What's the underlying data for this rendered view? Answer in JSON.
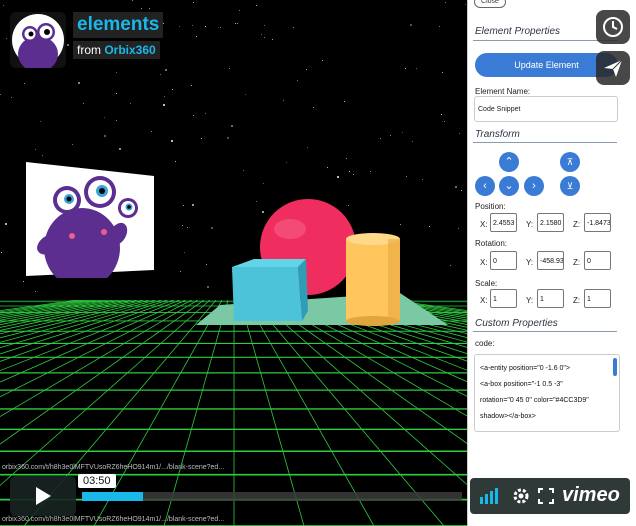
{
  "video": {
    "title": "elements",
    "from_prefix": "from",
    "channel": "Orbix360",
    "watermark": "orbix360.com/t/h8h3e0lMFTVUsoRZ6heHO914m1/.../blank-scene?ed...",
    "time": "03:50",
    "brand": "vimeo",
    "progress": 0.16
  },
  "panel": {
    "close_label": "Close",
    "element_properties": "Element Properties",
    "update_button": "Update Element",
    "element_name_label": "Element Name:",
    "element_name_value": "Code Snippet",
    "transform_title": "Transform",
    "position_label": "Position:",
    "position": {
      "x": "2.4553",
      "y": "2.1580",
      "z": "-1.8473"
    },
    "rotation_label": "Rotation:",
    "rotation": {
      "x": "0",
      "y": "-458.93",
      "z": "0"
    },
    "scale_label": "Scale:",
    "scale": {
      "x": "1",
      "y": "1",
      "z": "1"
    },
    "axis": {
      "x": "X:",
      "y": "Y:",
      "z": "Z:"
    },
    "custom_title": "Custom Properties",
    "code_label": "code:",
    "code_lines": [
      "<a-entity position=\"0 -1.6 0\">",
      "<a-box position=\"-1 0.5 -3\"",
      "rotation=\"0 45 0\" color=\"#4CC3D9\"",
      "shadow></a-box>"
    ]
  },
  "colors": {
    "accent": "#3a7bd5",
    "vimeo_blue": "#1ab7ea",
    "grid_green": "#2ecc40",
    "box": "#4cc3d9",
    "sphere": "#ef2d5e",
    "cylinder": "#ffc65d",
    "plane": "#7bc8a4"
  }
}
